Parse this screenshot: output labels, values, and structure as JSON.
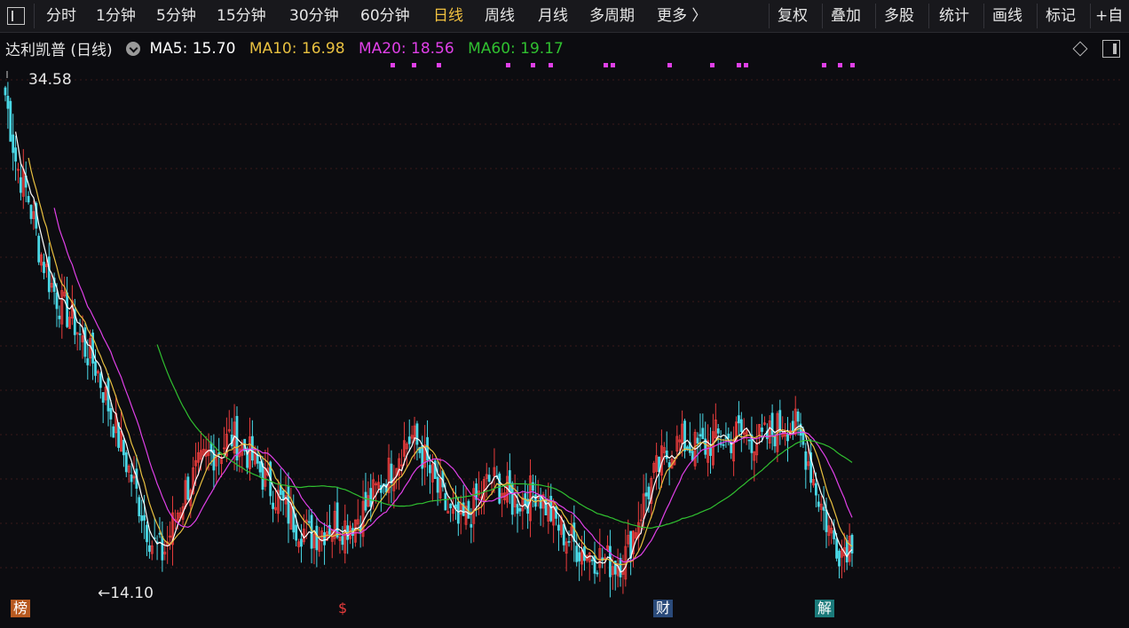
{
  "toolbar": {
    "periods": [
      "分时",
      "1分钟",
      "5分钟",
      "15分钟",
      "30分钟",
      "60分钟",
      "日线",
      "周线",
      "月线",
      "多周期",
      "更多 〉"
    ],
    "active_period": "日线",
    "tools": [
      "复权",
      "叠加",
      "多股",
      "统计",
      "画线",
      "标记",
      "+自"
    ]
  },
  "legend": {
    "title": "达利凯普 (日线)",
    "ma5": "MA5: 15.70",
    "ma10": "MA10: 16.98",
    "ma20": "MA20: 18.56",
    "ma60": "MA60: 19.17"
  },
  "chart": {
    "high_label": "34.58",
    "low_label": "←14.10",
    "tags": [
      "榜",
      "$",
      "财",
      "解"
    ],
    "colors": {
      "up": "#e83c3c",
      "down": "#4ad8e6",
      "ma5": "#ffffff",
      "ma10": "#e8c040",
      "ma20": "#e040e8",
      "ma60": "#30c030",
      "grid": "#3a1a1a"
    },
    "icons": [
      "settings-icon",
      "diamond-icon",
      "panel-toggle-icon"
    ]
  },
  "chart_data": {
    "type": "candlestick",
    "ylim": [
      13.5,
      35.5
    ],
    "high": 34.58,
    "low": 14.1,
    "series": [
      {
        "name": "MA5",
        "last": 15.7
      },
      {
        "name": "MA10",
        "last": 16.98
      },
      {
        "name": "MA20",
        "last": 18.56
      },
      {
        "name": "MA60",
        "last": 19.17
      }
    ],
    "close_path": [
      34.5,
      31.5,
      30.2,
      28.0,
      26.5,
      25.5,
      25.0,
      23.8,
      23.0,
      21.5,
      20.0,
      18.5,
      17.0,
      15.5,
      15.0,
      16.5,
      17.8,
      18.5,
      19.2,
      19.5,
      20.0,
      19.6,
      19.0,
      18.2,
      17.5,
      16.8,
      16.2,
      15.8,
      16.0,
      16.4,
      16.2,
      16.5,
      17.0,
      17.8,
      18.5,
      19.5,
      20.0,
      19.2,
      18.0,
      17.0,
      16.2,
      16.6,
      17.5,
      18.2,
      17.8,
      17.2,
      17.4,
      17.8,
      17.0,
      16.2,
      15.6,
      15.2,
      15.0,
      14.8,
      14.6,
      15.0,
      16.5,
      17.8,
      18.8,
      19.5,
      19.8,
      19.5,
      19.6,
      20.0,
      19.8,
      20.2,
      20.0,
      19.8,
      20.2,
      20.6,
      20.4,
      19.2,
      17.5,
      16.0,
      15.2,
      15.7
    ]
  }
}
